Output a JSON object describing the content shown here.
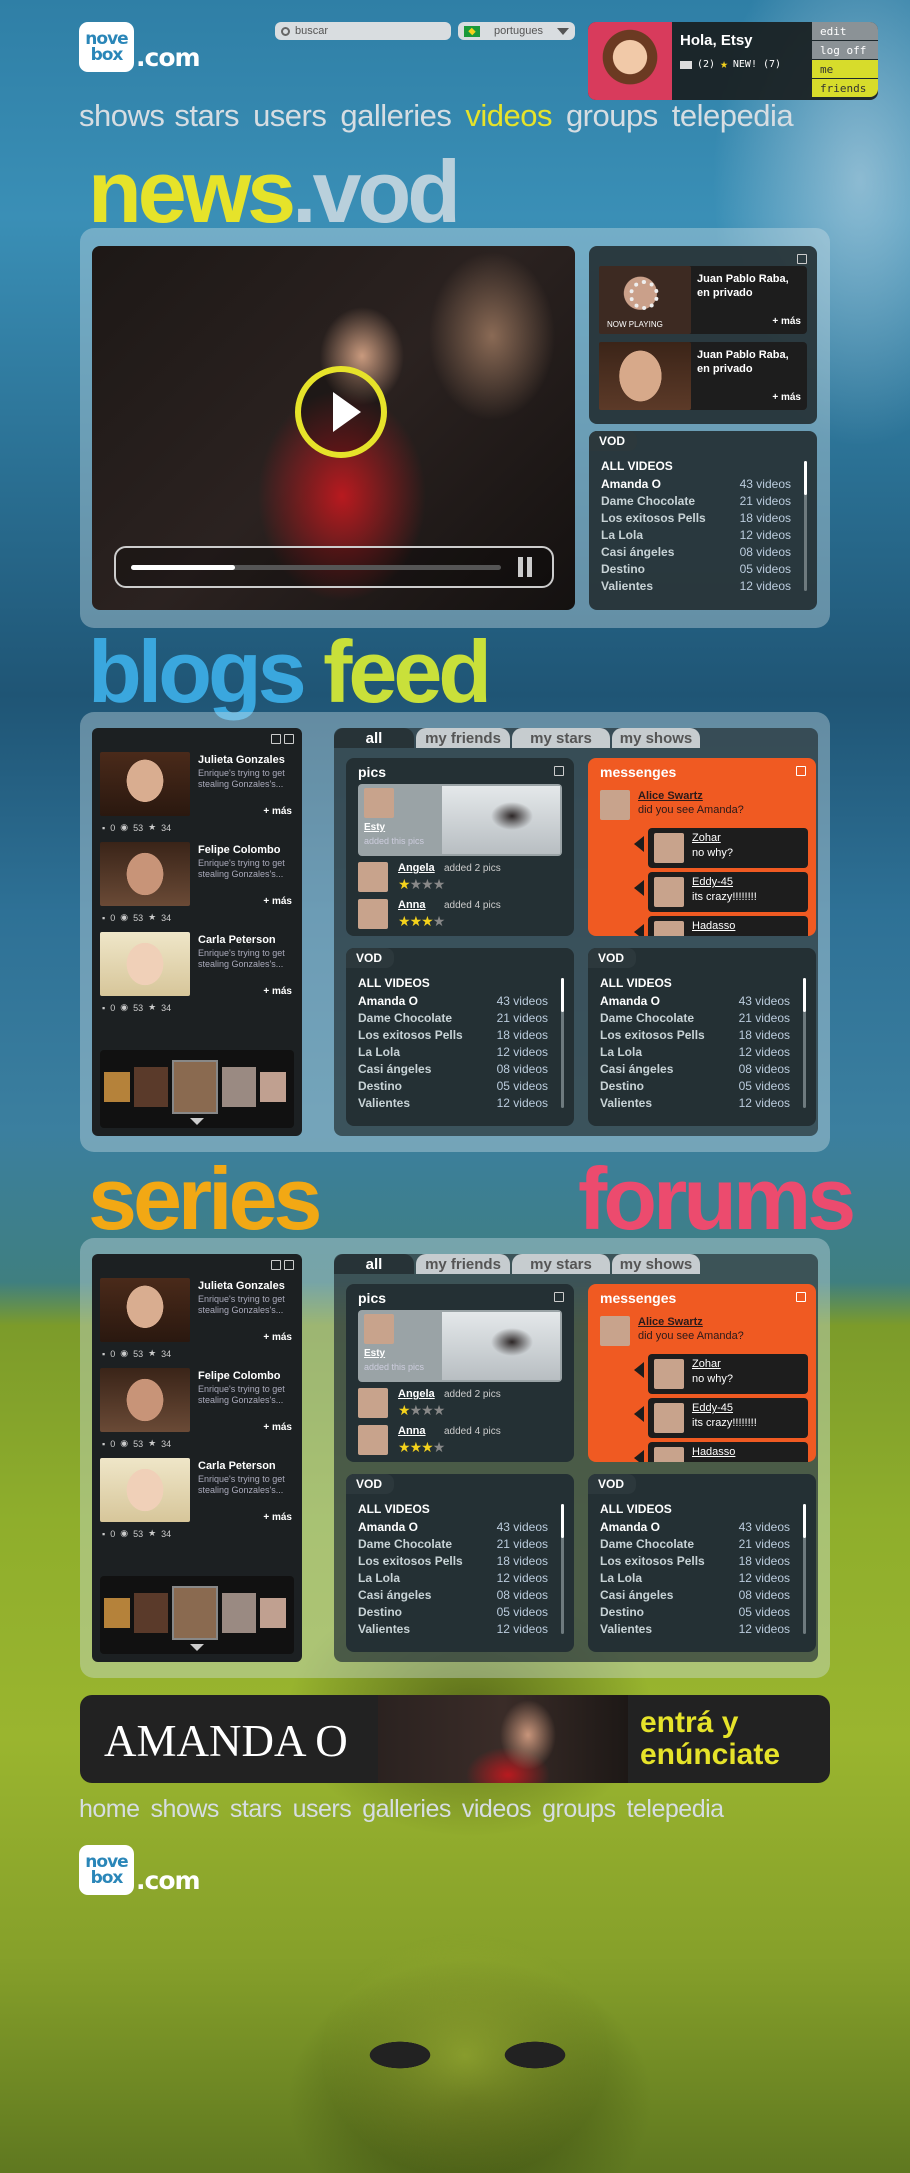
{
  "logo": {
    "box_top": "nove",
    "box_bottom": "box",
    "suffix": ".com"
  },
  "search": {
    "placeholder": "buscar"
  },
  "language": {
    "selected": "portugues"
  },
  "user": {
    "greeting": "Hola, Etsy",
    "messages": "(2)",
    "new_label": "NEW! (7)",
    "menu": [
      "edit",
      "log off",
      "me",
      "friends"
    ]
  },
  "nav": [
    "shows",
    "stars",
    "users",
    "galleries",
    "videos",
    "groups",
    "telepedia"
  ],
  "nav_active": "videos",
  "footer_nav": [
    "home",
    "shows",
    "stars",
    "users",
    "galleries",
    "videos",
    "groups",
    "telepedia"
  ],
  "sections": {
    "news_a": "news",
    "news_b": ".vod",
    "blogs": "blogs",
    "feed": "feed",
    "series": "series",
    "forums": "forums"
  },
  "player": {
    "progress": 0.28
  },
  "now_playing": [
    {
      "title": "Juan Pablo Raba, en privado",
      "more": "+ más",
      "badge": "NOW PLAYING"
    },
    {
      "title": "Juan Pablo Raba, en privado",
      "more": "+ más"
    }
  ],
  "vod": {
    "label": "VOD",
    "heading": "ALL VIDEOS",
    "items": [
      {
        "name": "Amanda O",
        "count": "43 videos"
      },
      {
        "name": "Dame Chocolate",
        "count": "21 videos"
      },
      {
        "name": "Los exitosos Pells",
        "count": "18 videos"
      },
      {
        "name": "La Lola",
        "count": "12 videos"
      },
      {
        "name": "Casi ángeles",
        "count": "08 videos"
      },
      {
        "name": "Destino",
        "count": "05 videos"
      },
      {
        "name": "Valientes",
        "count": "12 videos"
      }
    ]
  },
  "blogs": {
    "more": "+ más",
    "posts": [
      {
        "author": "Julieta Gonzales",
        "text": "Enrique's trying to get stealing Gonzales's...",
        "comments": "0",
        "views": "53",
        "stars": "34"
      },
      {
        "author": "Felipe Colombo",
        "text": "Enrique's trying to get stealing Gonzales's...",
        "comments": "0",
        "views": "53",
        "stars": "34"
      },
      {
        "author": "Carla Peterson",
        "text": "Enrique's trying to get stealing Gonzales's...",
        "comments": "0",
        "views": "53",
        "stars": "34"
      }
    ]
  },
  "feed_tabs": [
    "all",
    "my friends",
    "my stars",
    "my shows"
  ],
  "pics": {
    "title": "pics",
    "poster": "Esty",
    "poster_note": "added this pics",
    "entries": [
      {
        "user": "Angela",
        "action": "added 2 pics",
        "rating": 1
      },
      {
        "user": "Anna",
        "action": "added 4 pics",
        "rating": 3
      }
    ]
  },
  "messenges": {
    "title": "messenges",
    "first_user": "Alice Swartz",
    "first_text": "did you see Amanda?",
    "replies": [
      {
        "user": "Zohar",
        "text": "no why?"
      },
      {
        "user": "Eddy-45",
        "text": "its crazy!!!!!!!!"
      },
      {
        "user": "Hadasso",
        "text": ""
      }
    ]
  },
  "banner": {
    "title": "AMANDA O",
    "tagline_1": "entrá y",
    "tagline_2": "enúnciate"
  },
  "colors": {
    "yellow": "#e6e32a",
    "blue": "#3aa7de",
    "lime": "#c9e03a",
    "orange": "#f2a814",
    "pink": "#ec4b6e",
    "messenges": "#f05a22"
  }
}
